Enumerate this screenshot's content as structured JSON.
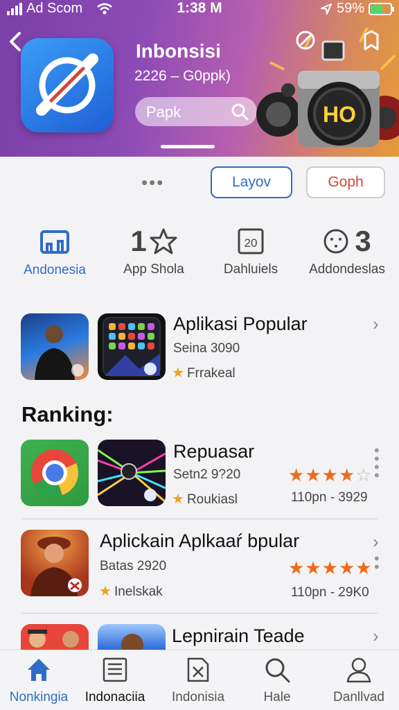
{
  "status_bar": {
    "carrier": "Ad Scom",
    "time": "1:38 M",
    "battery": "59%",
    "battery_level": 0.59
  },
  "colors": {
    "accent": "#2f6cc6",
    "star": "#f06a1b",
    "tag_star": "#f0a21b",
    "secondary_button_text": "#d9433a"
  },
  "app": {
    "title": "Inbonsisi",
    "subtitle": "2226 – G0ppk)",
    "search_placeholder": "Papk"
  },
  "actions": {
    "primary": "Layov",
    "secondary": "Goph"
  },
  "stats": [
    {
      "icon": "monitor-icon",
      "label": "Andonesia"
    },
    {
      "value": "1",
      "icon": "star-outline-icon",
      "label": "App Shola"
    },
    {
      "icon": "calendar-icon",
      "badge": "20",
      "label": "Dahluiels"
    },
    {
      "icon": "face-icon",
      "value": "3",
      "label": "Addondeslas"
    }
  ],
  "featured": {
    "title": "Aplikasi Popular",
    "subtitle": "Seina 3090",
    "tag": "Frrakeal"
  },
  "ranking": {
    "title": "Ranking:",
    "items": [
      {
        "title": "Repuasar",
        "subtitle": "Setn2 9?20",
        "tag": "Roukiasl",
        "rating": 4,
        "downloads": "110pn - 3929"
      },
      {
        "title": "Aplickain Aplkaaŕ bpular",
        "subtitle": "Batas 2920",
        "tag": "Inelskak",
        "rating": 5,
        "downloads": "110pn - 29K0"
      },
      {
        "title": "Lepnirain Teade"
      }
    ]
  },
  "bottom_nav": [
    {
      "label": "Nonkingia",
      "icon": "home-icon",
      "active": true
    },
    {
      "label": "Indonaciia",
      "icon": "news-icon"
    },
    {
      "label": "Indonisia",
      "icon": "document-icon"
    },
    {
      "label": "Hale",
      "icon": "search-icon"
    },
    {
      "label": "Danllvad",
      "icon": "person-icon"
    }
  ]
}
